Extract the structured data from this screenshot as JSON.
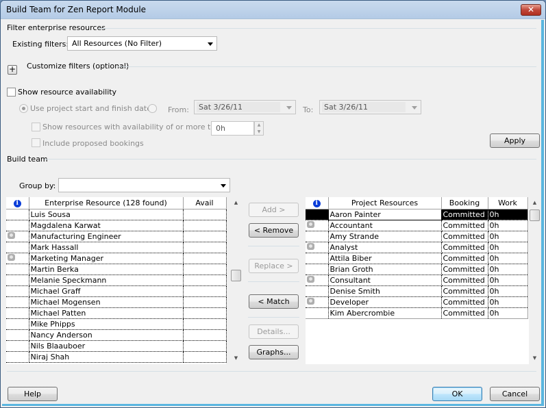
{
  "window": {
    "title": "Build Team for Zen Report Module",
    "close_label": "✕"
  },
  "filter_section": {
    "title": "Filter enterprise resources",
    "existing_filters_label": "Existing filters:",
    "existing_filters_value": "All Resources (No Filter)",
    "customize_expand_label": "+",
    "customize_label": "Customize filters (optional)"
  },
  "availability": {
    "show_label": "Show resource availability",
    "show_checked": false,
    "use_project_dates_label": "Use project start and finish dates",
    "from_label": "From:",
    "from_value": "Sat 3/26/11",
    "to_label": "To:",
    "to_value": "Sat 3/26/11",
    "show_min_label": "Show resources with availability of or more than:",
    "min_value": "0h",
    "include_proposed_label": "Include proposed bookings",
    "apply_label": "Apply"
  },
  "build_team": {
    "title": "Build team",
    "group_by_label": "Group by:",
    "group_by_value": ""
  },
  "enterprise_grid": {
    "columns": [
      "i",
      "Enterprise Resource (128 found)",
      "Avail"
    ],
    "rows": [
      {
        "generic": false,
        "name": "Luis Sousa",
        "avail": ""
      },
      {
        "generic": false,
        "name": "Magdalena Karwat",
        "avail": ""
      },
      {
        "generic": true,
        "name": "Manufacturing Engineer",
        "avail": ""
      },
      {
        "generic": false,
        "name": "Mark Hassall",
        "avail": ""
      },
      {
        "generic": true,
        "name": "Marketing Manager",
        "avail": ""
      },
      {
        "generic": false,
        "name": "Martin Berka",
        "avail": ""
      },
      {
        "generic": false,
        "name": "Melanie Speckmann",
        "avail": ""
      },
      {
        "generic": false,
        "name": "Michael Graff",
        "avail": ""
      },
      {
        "generic": false,
        "name": "Michael Mogensen",
        "avail": ""
      },
      {
        "generic": false,
        "name": "Michael Patten",
        "avail": ""
      },
      {
        "generic": false,
        "name": "Mike Phipps",
        "avail": ""
      },
      {
        "generic": false,
        "name": "Nancy Anderson",
        "avail": ""
      },
      {
        "generic": false,
        "name": "Nils Blaauboer",
        "avail": ""
      },
      {
        "generic": false,
        "name": "Niraj Shah",
        "avail": ""
      }
    ]
  },
  "middle_buttons": {
    "add": "Add >",
    "remove": "< Remove",
    "replace": "Replace >",
    "match": "< Match",
    "details": "Details...",
    "graphs": "Graphs..."
  },
  "project_grid": {
    "columns": [
      "i",
      "Project Resources",
      "Booking",
      "Work"
    ],
    "rows": [
      {
        "generic": false,
        "name": "Aaron Painter",
        "booking": "Committed",
        "work": "0h",
        "selected": true
      },
      {
        "generic": true,
        "name": "Accountant",
        "booking": "Committed",
        "work": "0h"
      },
      {
        "generic": false,
        "name": "Amy Strande",
        "booking": "Committed",
        "work": "0h"
      },
      {
        "generic": true,
        "name": "Analyst",
        "booking": "Committed",
        "work": "0h"
      },
      {
        "generic": false,
        "name": "Attila Biber",
        "booking": "Committed",
        "work": "0h"
      },
      {
        "generic": false,
        "name": "Brian Groth",
        "booking": "Committed",
        "work": "0h"
      },
      {
        "generic": true,
        "name": "Consultant",
        "booking": "Committed",
        "work": "0h"
      },
      {
        "generic": false,
        "name": "Denise Smith",
        "booking": "Committed",
        "work": "0h"
      },
      {
        "generic": true,
        "name": "Developer",
        "booking": "Committed",
        "work": "0h"
      },
      {
        "generic": false,
        "name": "Kim Abercrombie",
        "booking": "Committed",
        "work": "0h"
      }
    ]
  },
  "footer": {
    "help": "Help",
    "ok": "OK",
    "cancel": "Cancel"
  }
}
